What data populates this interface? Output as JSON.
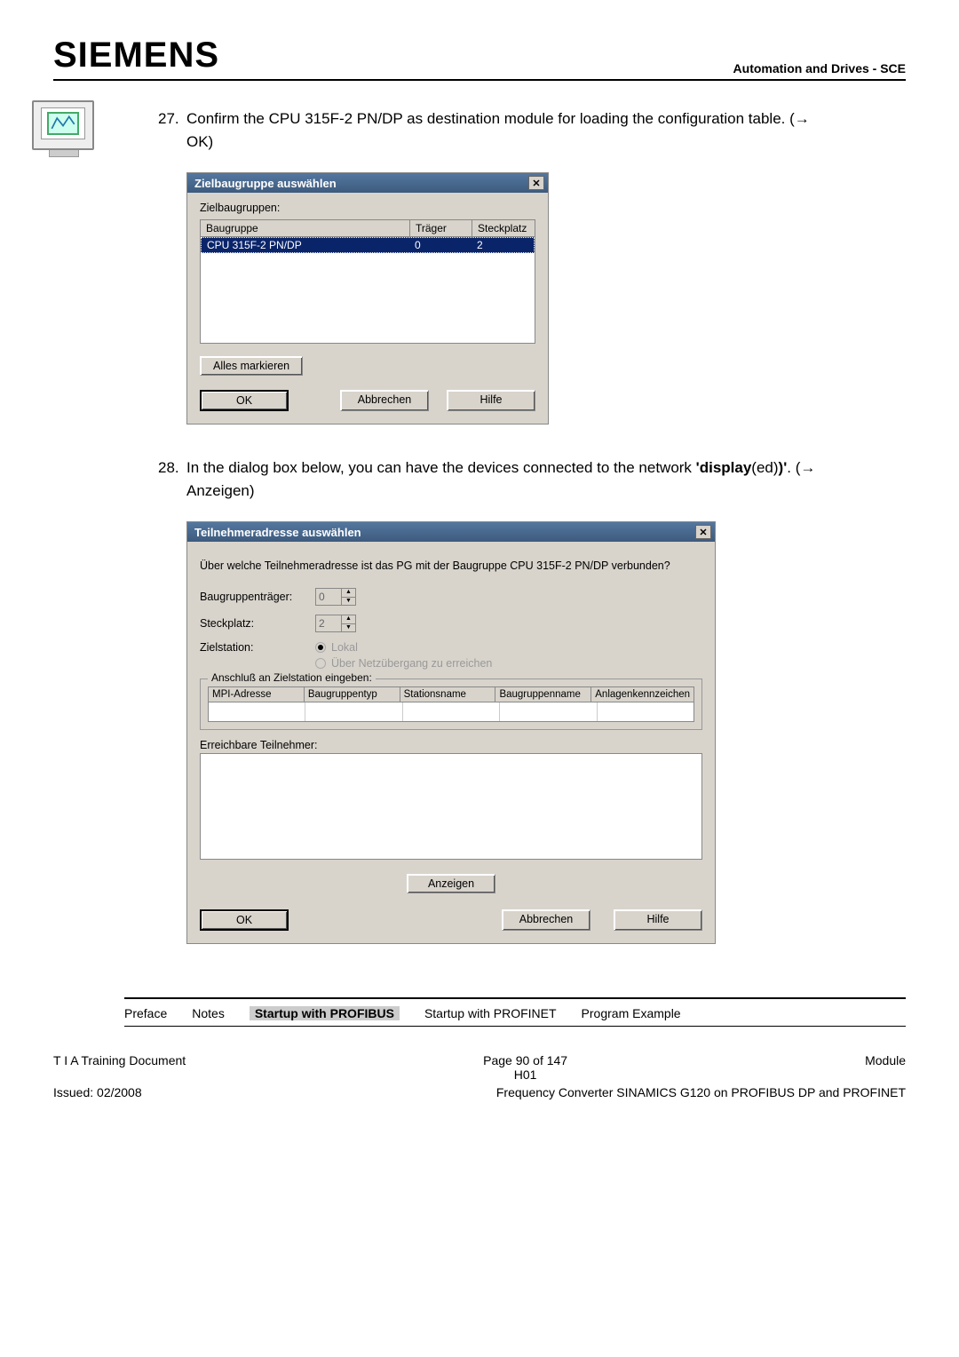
{
  "header": {
    "logo": "SIEMENS",
    "right": "Automation and Drives - SCE"
  },
  "steps": {
    "s27": {
      "num": "27.",
      "text_a": "Confirm the CPU 315F-2 PN/DP as destination module for loading the configuration table. (→",
      "text_b": "OK)"
    },
    "s28": {
      "num": "28.",
      "text_a": "In the dialog box below, you can have the devices connected to the network ",
      "bold": "'display",
      "text_b": "(ed)",
      "bold2": ")'",
      "text_c": ". (→",
      "text_d": "Anzeigen)"
    }
  },
  "dialog1": {
    "title": "Zielbaugruppe auswählen",
    "label": "Zielbaugruppen:",
    "cols": {
      "c1": "Baugruppe",
      "c2": "Träger",
      "c3": "Steckplatz"
    },
    "row": {
      "c1": "CPU 315F-2 PN/DP",
      "c2": "0",
      "c3": "2"
    },
    "allesMarkieren": "Alles markieren",
    "ok": "OK",
    "abbrechen": "Abbrechen",
    "hilfe": "Hilfe"
  },
  "dialog2": {
    "title": "Teilnehmeradresse auswählen",
    "desc": "Über welche Teilnehmeradresse ist das PG mit der Baugruppe CPU 315F-2 PN/DP verbunden?",
    "baugruppentraeger_lbl": "Baugruppenträger:",
    "baugruppentraeger_val": "0",
    "steckplatz_lbl": "Steckplatz:",
    "steckplatz_val": "2",
    "zielstation_lbl": "Zielstation:",
    "radio_lokal": "Lokal",
    "radio_netz": "Über Netzübergang zu erreichen",
    "group_title": "Anschluß an Zielstation eingeben:",
    "gc1": "MPI-Adresse",
    "gc2": "Baugruppentyp",
    "gc3": "Stationsname",
    "gc4": "Baugruppenname",
    "gc5": "Anlagenkennzeichen",
    "reach_lbl": "Erreichbare Teilnehmer:",
    "anzeigen": "Anzeigen",
    "ok": "OK",
    "abbrechen": "Abbrechen",
    "hilfe": "Hilfe"
  },
  "footerTabs": {
    "t1": "Preface",
    "t2": "Notes",
    "t3": "Startup with PROFIBUS",
    "t4": "Startup with PROFINET",
    "t5": "Program Example"
  },
  "meta": {
    "left1": "T I A  Training Document",
    "center1a": "Page 90 of 147",
    "center1b": "H01",
    "right1": "Module",
    "left2": "Issued: 02/2008",
    "right2": "Frequency Converter SINAMICS G120 on PROFIBUS DP and PROFINET"
  }
}
